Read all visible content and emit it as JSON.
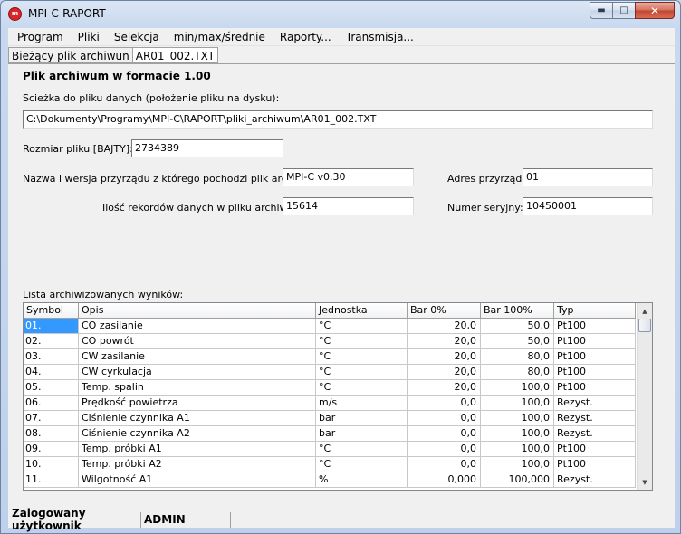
{
  "window": {
    "title": "MPI-C-RAPORT",
    "app_icon_text": "m",
    "minimize_icon": "minimize-icon",
    "maximize_icon": "maximize-icon",
    "close_icon": "close-icon"
  },
  "menu": [
    "Program",
    "Pliki",
    "Selekcja",
    "min/max/średnie",
    "Raporty...",
    "Transmisja..."
  ],
  "tabs": {
    "label": "Bieżący plik archiwun",
    "file": "AR01_002.TXT"
  },
  "archive": {
    "heading": "Plik archiwum w formacie 1.00",
    "path_label": "Scieżka do pliku danych (położenie pliku na dysku):",
    "path_value": "C:\\Dokumenty\\Programy\\MPI-C\\RAPORT\\pliki_archiwum\\AR01_002.TXT",
    "size_label": "Rozmiar pliku [BAJTY]:",
    "size_value": "2734389",
    "device_label": "Nazwa i wersja przyrządu z którego pochodzi plik archiwum:",
    "device_value": "MPI-C v0.30",
    "address_label": "Adres przyrządu:",
    "address_value": "01",
    "records_label": "Ilość rekordów danych w pliku archiwum:",
    "records_value": "15614",
    "serial_label": "Numer seryjny:",
    "serial_value": "10450001"
  },
  "results": {
    "label": "Lista archiwizowanych wyników:",
    "columns": [
      "Symbol",
      "Opis",
      "Jednostka",
      "Bar 0%",
      "Bar 100%",
      "Typ"
    ],
    "rows": [
      [
        "01.",
        "CO zasilanie",
        "°C",
        "20,0",
        "50,0",
        "Pt100"
      ],
      [
        "02.",
        "CO powrót",
        "°C",
        "20,0",
        "50,0",
        "Pt100"
      ],
      [
        "03.",
        "CW zasilanie",
        "°C",
        "20,0",
        "80,0",
        "Pt100"
      ],
      [
        "04.",
        "CW cyrkulacja",
        "°C",
        "20,0",
        "80,0",
        "Pt100"
      ],
      [
        "05.",
        "Temp. spalin",
        "°C",
        "20,0",
        "100,0",
        "Pt100"
      ],
      [
        "06.",
        "Prędkość powietrza",
        "m/s",
        "0,0",
        "100,0",
        "Rezyst."
      ],
      [
        "07.",
        "Ciśnienie czynnika A1",
        "bar",
        "0,0",
        "100,0",
        "Rezyst."
      ],
      [
        "08.",
        "Ciśnienie czynnika A2",
        "bar",
        "0,0",
        "100,0",
        "Rezyst."
      ],
      [
        "09.",
        "Temp. próbki A1",
        "°C",
        "0,0",
        "100,0",
        "Pt100"
      ],
      [
        "10.",
        "Temp. próbki A2",
        "°C",
        "0,0",
        "100,0",
        "Pt100"
      ],
      [
        "11.",
        "Wilgotność A1",
        "%",
        "0,000",
        "100,000",
        "Rezyst."
      ]
    ]
  },
  "status": {
    "label": "Zalogowany użytkownik",
    "value": "ADMIN"
  }
}
